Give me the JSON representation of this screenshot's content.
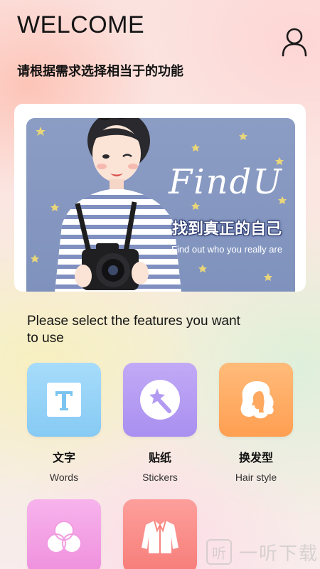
{
  "header": {
    "title": "WELCOME",
    "subtitle": "请根据需求选择相当于的功能",
    "user_icon": "user-icon"
  },
  "banner": {
    "brand": "FindU",
    "slogan_cn": "找到真正的自己",
    "slogan_en": "Find out who you really are",
    "camera_brand": "Canon"
  },
  "features_prompt": "Please select the features you want to use",
  "features": [
    {
      "label_cn": "文字",
      "label_en": "Words",
      "icon": "text-t-icon",
      "color": "#8fd2f7"
    },
    {
      "label_cn": "贴纸",
      "label_en": "Stickers",
      "icon": "magic-wand-icon",
      "color": "#b49af3"
    },
    {
      "label_cn": "换发型",
      "label_en": "Hair style",
      "icon": "hair-profile-icon",
      "color": "#ffab62"
    },
    {
      "label_cn": "",
      "label_en": "",
      "icon": "three-circles-icon",
      "color": "#f39ce3"
    },
    {
      "label_cn": "",
      "label_en": "",
      "icon": "jacket-icon",
      "color": "#fb8c89"
    }
  ],
  "watermark": {
    "glyph": "听",
    "text": "一听下载"
  }
}
